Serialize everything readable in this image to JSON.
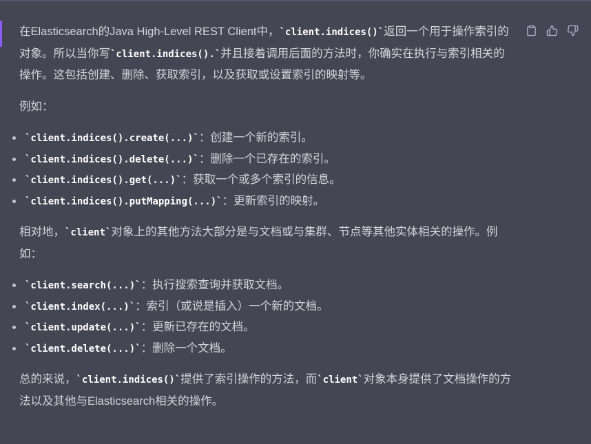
{
  "message": {
    "p1": [
      "在Elasticsearch的Java High-Level REST Client中，",
      "`client.indices()`",
      "返回一个用于操作索引的对象。所以当你写",
      "`client.indices().`",
      "并且接着调用后面的方法时，你确实在执行与索引相关的操作。这包括创建、删除、获取索引，以及获取或设置索引的映射等。"
    ],
    "p2": "例如：",
    "list1": [
      {
        "code": "`client.indices().create(...)`",
        "desc": "：创建一个新的索引。"
      },
      {
        "code": "`client.indices().delete(...)`",
        "desc": "：删除一个已存在的索引。"
      },
      {
        "code": "`client.indices().get(...)`",
        "desc": "：获取一个或多个索引的信息。"
      },
      {
        "code": "`client.indices().putMapping(...)`",
        "desc": "：更新索引的映射。"
      }
    ],
    "p3": [
      "相对地，",
      "`client`",
      "对象上的其他方法大部分是与文档或与集群、节点等其他实体相关的操作。例如："
    ],
    "list2": [
      {
        "code": "`client.search(...)`",
        "desc": "：执行搜索查询并获取文档。"
      },
      {
        "code": "`client.index(...)`",
        "desc": "：索引（或说是插入）一个新的文档。"
      },
      {
        "code": "`client.update(...)`",
        "desc": "：更新已存在的文档。"
      },
      {
        "code": "`client.delete(...)`",
        "desc": "：删除一个文档。"
      }
    ],
    "p4": [
      "总的来说，",
      "`client.indices()`",
      "提供了索引操作的方法，而",
      "`client`",
      "对象本身提供了文档操作的方法以及其他与Elasticsearch相关的操作。"
    ]
  },
  "actions": {
    "copy_icon": "clipboard-icon",
    "like_icon": "thumbs-up-icon",
    "dislike_icon": "thumbs-down-icon"
  },
  "colors": {
    "background": "#444654",
    "text": "#d1d5db",
    "code": "#ffffff",
    "accent": "#8b5cf6"
  }
}
